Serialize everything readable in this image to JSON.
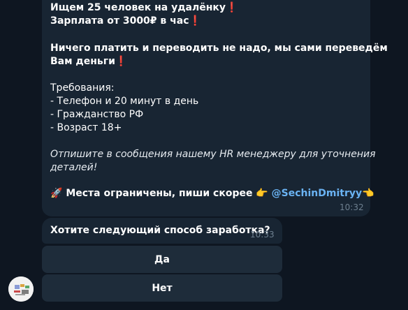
{
  "message": {
    "lines": [
      "Ищем 25 человек на удалёнку",
      "Зарплата от 3000₽ в час",
      "Ничего платить и переводить не надо, мы сами переведём",
      "Вам деньги",
      "Требования:",
      "- Телефон и 20 минут в день",
      "- Гражданство РФ",
      "- Возраст 18+",
      "Отпишите в сообщения нашему HR менеджеру для уточнения",
      "деталей!",
      "Места ограничены, пиши скорее",
      "@SechinDmitryy"
    ],
    "time": "10:32",
    "icons": [
      "exclamation-mark-icon",
      "rocket-icon",
      "pointing-hand-icon"
    ]
  },
  "question": {
    "text": "Хотите следующий способ заработка?",
    "time": "10:33"
  },
  "buttons": {
    "yes": "Да",
    "no": "Нет"
  },
  "colors": {
    "background": "#0e1621",
    "bubble": "#182533",
    "button": "#1e2c3a",
    "link": "#6ab3f3",
    "exclamation": "#e8322e",
    "timestamp": "#6d7f8f"
  }
}
